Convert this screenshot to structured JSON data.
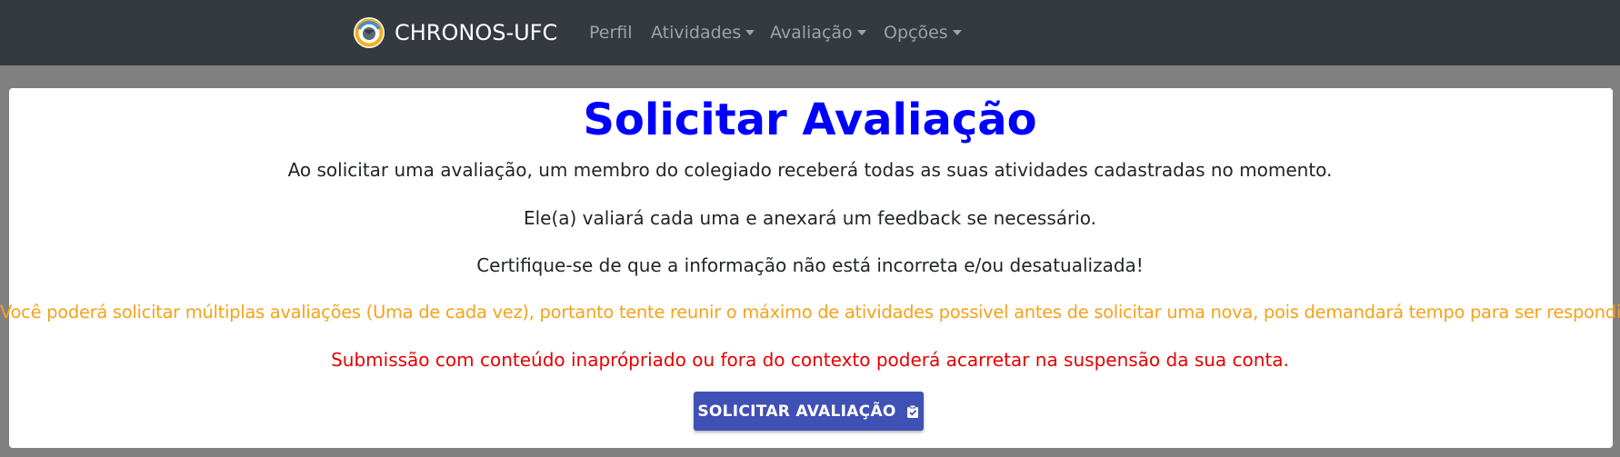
{
  "navbar": {
    "brand": "CHRONOS-UFC",
    "items": [
      {
        "label": "Perfil",
        "dropdown": false
      },
      {
        "label": "Atividades",
        "dropdown": true
      },
      {
        "label": "Avaliação",
        "dropdown": true
      },
      {
        "label": "Opções",
        "dropdown": true
      }
    ]
  },
  "main": {
    "title": "Solicitar Avaliação",
    "paragraphs": [
      "Ao solicitar uma avaliação, um membro do colegiado receberá todas as suas atividades cadastradas no momento.",
      "Ele(a) valiará cada uma e anexará um feedback se necessário.",
      "Certifique-se de que a informação não está incorreta e/ou desatualizada!",
      "Você poderá solicitar múltiplas avaliações (Uma de cada vez), portanto tente reunir o máximo de atividades possivel antes de solicitar uma nova, pois demandará tempo para ser respondido.",
      "Submissão com conteúdo inaprópriado ou fora do contexto poderá acarretar na suspensão da sua conta."
    ],
    "button_label": "SOLICITAR AVALIAÇÃO",
    "button_icon": "clipboard-check-icon"
  },
  "colors": {
    "navbar": "#343a40",
    "title": "#0000ff",
    "warning": "#f5a21b",
    "danger": "#e60000",
    "button": "#3f51b5"
  }
}
